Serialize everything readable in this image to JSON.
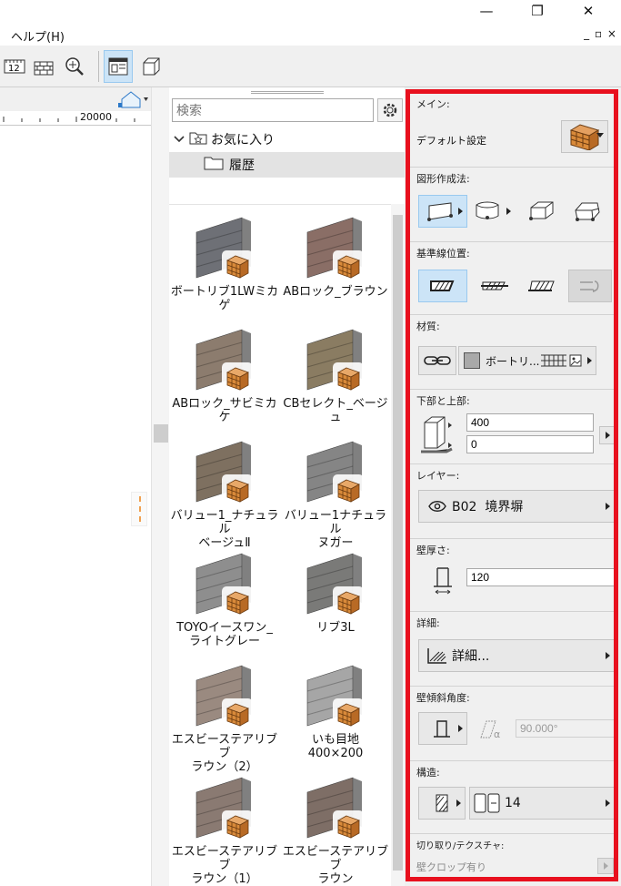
{
  "menu": {
    "help": "ヘルプ(H)",
    "window_controls": "_ ▫ ×"
  },
  "title_bar": {
    "minimize": "—",
    "restore": "❐",
    "close": "✕"
  },
  "ruler": {
    "label": "20000"
  },
  "library": {
    "search_placeholder": "検索",
    "tree": [
      {
        "label": "お気に入り"
      },
      {
        "label": "履歴"
      }
    ],
    "items": [
      {
        "label": "ボートリブ1LWミカ\nゲ",
        "wall_color": "#6e7076"
      },
      {
        "label": "ABロック_ブラウン",
        "wall_color": "#8a6e66"
      },
      {
        "label": "ABロック_サビミカケ",
        "wall_color": "#8c7c6e"
      },
      {
        "label": "CBセレクト_ベージ\nュ",
        "wall_color": "#8a7c62"
      },
      {
        "label": "バリュー1_ナチュラル\nベージュⅡ",
        "wall_color": "#7e7060"
      },
      {
        "label": "バリュー1ナチュラル\nヌガー",
        "wall_color": "#858585"
      },
      {
        "label": "TOYOイースワン_\nライトグレー",
        "wall_color": "#8e8e8e"
      },
      {
        "label": "リブ3L",
        "wall_color": "#7a7a78"
      },
      {
        "label": "エスビーステアリブブ\nラウン（2）",
        "wall_color": "#9a8a80"
      },
      {
        "label": "いも目地\n400×200",
        "wall_color": "#a6a6a6"
      },
      {
        "label": "エスビーステアリブブ\nラウン（1）",
        "wall_color": "#8a7a72"
      },
      {
        "label": "エスビーステアリブブ\nラウン",
        "wall_color": "#7e6e66"
      }
    ]
  },
  "settings": {
    "main": {
      "title": "メイン:",
      "default_label": "デフォルト設定"
    },
    "geometry": {
      "title": "図形作成法:"
    },
    "reference_line": {
      "title": "基準線位置:"
    },
    "material": {
      "title": "材質:",
      "surface_label": "ボートリ..."
    },
    "top_bottom": {
      "title": "下部と上部:",
      "top_value": "400",
      "bottom_value": "0"
    },
    "layer": {
      "title": "レイヤー:",
      "value": "B02  境界塀"
    },
    "thickness": {
      "title": "壁厚さ:",
      "value": "120"
    },
    "detail": {
      "title": "詳細:",
      "value": "詳細..."
    },
    "slant": {
      "title": "壁傾斜角度:",
      "angle": "90.000°"
    },
    "structure": {
      "title": "構造:",
      "value": "14"
    },
    "cutting": {
      "title": "切り取り/テクスチャ:",
      "value": "壁クロップ有り"
    }
  },
  "colors": {
    "highlight_frame": "#e8101e",
    "active_button": "#cce4f7",
    "brick": "#d98a3a"
  }
}
